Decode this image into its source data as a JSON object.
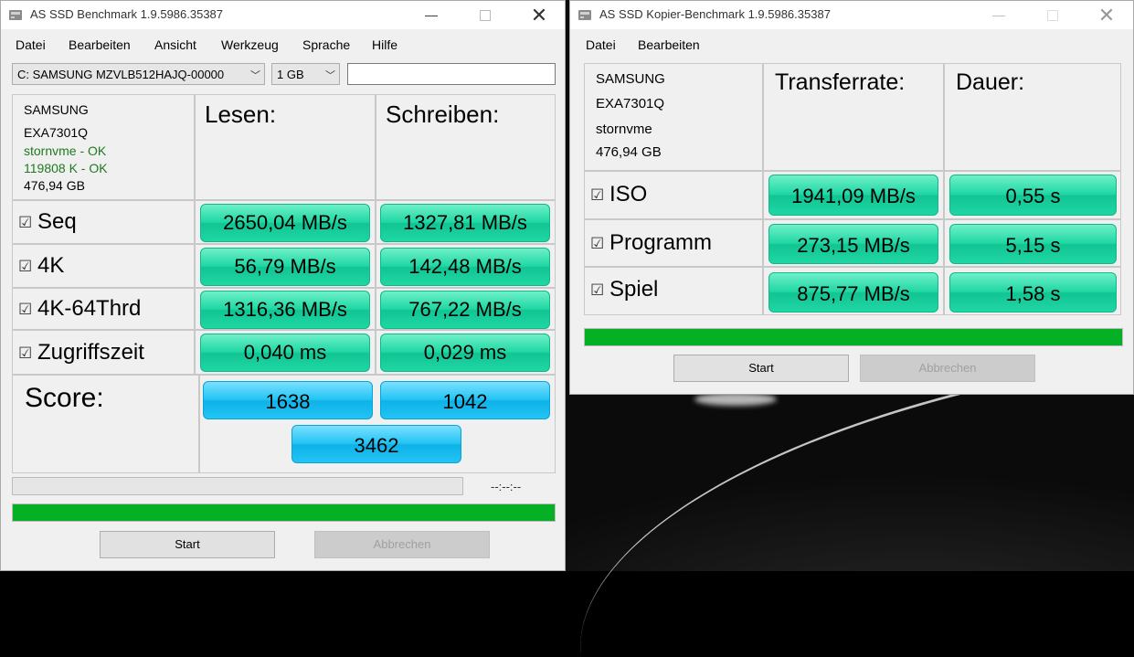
{
  "window_main": {
    "title": "AS SSD Benchmark 1.9.5986.35387",
    "menu": [
      "Datei",
      "Bearbeiten",
      "Ansicht",
      "Werkzeug",
      "Sprache",
      "Hilfe"
    ],
    "drive_select": "C: SAMSUNG MZVLB512HAJQ-00000",
    "size_select": "1 GB",
    "textbox_value": "",
    "drive_info": {
      "vendor": "SAMSUNG",
      "firmware": "EXA7301Q",
      "driver": "stornvme - OK",
      "alignment": "119808 K - OK",
      "capacity": "476,94 GB"
    },
    "headers": {
      "read": "Lesen:",
      "write": "Schreiben:"
    },
    "rows": [
      {
        "label": "Seq",
        "checked": "☑",
        "read": "2650,04 MB/s",
        "write": "1327,81 MB/s"
      },
      {
        "label": "4K",
        "checked": "☑",
        "read": "56,79 MB/s",
        "write": "142,48 MB/s"
      },
      {
        "label": "4K-64Thrd",
        "checked": "☑",
        "read": "1316,36 MB/s",
        "write": "767,22 MB/s"
      },
      {
        "label": "Zugriffszeit",
        "checked": "☑",
        "read": "0,040 ms",
        "write": "0,029 ms"
      }
    ],
    "score": {
      "label": "Score:",
      "read": "1638",
      "write": "1042",
      "total": "3462"
    },
    "time_display": "--:--:--",
    "progress_fraction": 1.0,
    "buttons": {
      "start": "Start",
      "cancel": "Abbrechen"
    }
  },
  "window_copy": {
    "title": "AS SSD Kopier-Benchmark 1.9.5986.35387",
    "menu": [
      "Datei",
      "Bearbeiten"
    ],
    "drive_info": {
      "vendor": "SAMSUNG",
      "firmware": "EXA7301Q",
      "driver": "stornvme",
      "capacity": "476,94 GB"
    },
    "headers": {
      "rate": "Transferrate:",
      "duration": "Dauer:"
    },
    "rows": [
      {
        "label": "ISO",
        "checked": "☑",
        "rate": "1941,09 MB/s",
        "duration": "0,55 s"
      },
      {
        "label": "Programm",
        "checked": "☑",
        "rate": "273,15 MB/s",
        "duration": "5,15 s"
      },
      {
        "label": "Spiel",
        "checked": "☑",
        "rate": "875,77 MB/s",
        "duration": "1,58 s"
      }
    ],
    "progress_fraction": 1.0,
    "buttons": {
      "start": "Start",
      "cancel": "Abbrechen"
    }
  },
  "colors": {
    "result_green": "#1fd7a4",
    "score_blue": "#22c4f4",
    "progress_green": "#06b025",
    "ok_text": "#1f7a1f"
  }
}
